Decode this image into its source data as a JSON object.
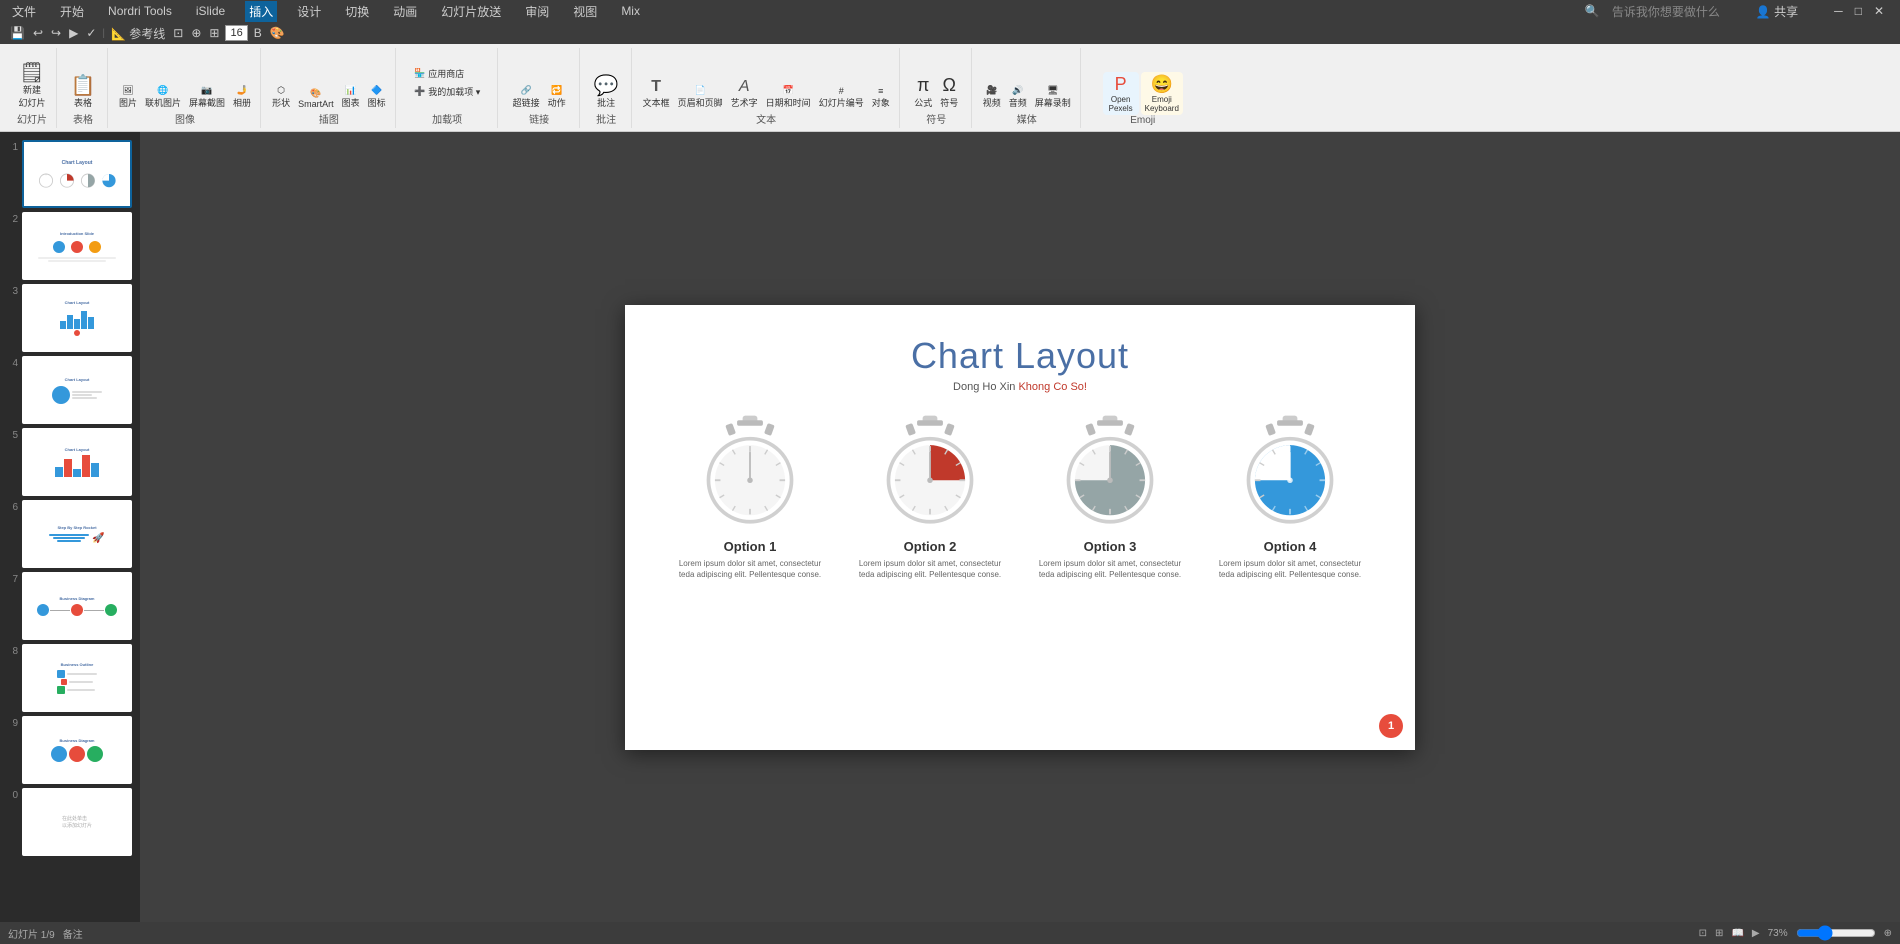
{
  "menubar": {
    "items": [
      "文件",
      "开始",
      "Nordri Tools",
      "iSlide",
      "插入",
      "设计",
      "切换",
      "动画",
      "幻灯片放送",
      "审阅",
      "视图",
      "Mix",
      "告诉我你想要做什么"
    ],
    "active": "插入"
  },
  "ribbon": {
    "tabs": [
      "文件",
      "开始",
      "Nordri Tools",
      "iSlide",
      "插入",
      "设计",
      "切换",
      "动画",
      "幻灯片放送",
      "审阅",
      "视图",
      "Mix"
    ],
    "active_tab": "插入",
    "groups": [
      {
        "label": "幻灯片",
        "items": [
          {
            "icon": "🗒",
            "label": "新建幻灯片"
          },
          {
            "icon": "📋",
            "label": "表格"
          }
        ]
      },
      {
        "label": "图像",
        "items": [
          {
            "icon": "🖼",
            "label": "图片"
          },
          {
            "icon": "🔗",
            "label": "联机图片"
          },
          {
            "icon": "📷",
            "label": "屏幕截图"
          },
          {
            "icon": "🤳",
            "label": "相册"
          }
        ]
      },
      {
        "label": "插图",
        "items": [
          {
            "icon": "⬡",
            "label": "形状"
          },
          {
            "icon": "📊",
            "label": "图表"
          },
          {
            "icon": "🎨",
            "label": "SmartArt"
          }
        ]
      },
      {
        "label": "加载项",
        "items": [
          {
            "icon": "🏪",
            "label": "应用商店"
          },
          {
            "icon": "➕",
            "label": "我的加载项"
          }
        ]
      },
      {
        "label": "链接",
        "items": [
          {
            "icon": "🔗",
            "label": "超链接"
          },
          {
            "icon": "🔁",
            "label": "动作"
          }
        ]
      },
      {
        "label": "批注",
        "items": [
          {
            "icon": "💬",
            "label": "批注"
          }
        ]
      },
      {
        "label": "文本",
        "items": [
          {
            "icon": "T",
            "label": "文本框"
          },
          {
            "icon": "📄",
            "label": "页眉和页脚"
          },
          {
            "icon": "A",
            "label": "艺术字"
          },
          {
            "icon": "📅",
            "label": "日期和时间"
          },
          {
            "icon": "#",
            "label": "幻灯片编号"
          },
          {
            "icon": "≡",
            "label": "对象"
          }
        ]
      },
      {
        "label": "符号",
        "items": [
          {
            "icon": "π",
            "label": "公式"
          },
          {
            "icon": "Ω",
            "label": "符号"
          }
        ]
      },
      {
        "label": "媒体",
        "items": [
          {
            "icon": "🎥",
            "label": "视频"
          },
          {
            "icon": "🔊",
            "label": "音频"
          },
          {
            "icon": "🖥",
            "label": "屏幕录制"
          }
        ]
      },
      {
        "label": "",
        "items": [
          {
            "icon": "P",
            "label": "Open Pexels"
          },
          {
            "icon": "😄",
            "label": "Emoji Keyboard"
          }
        ]
      }
    ]
  },
  "quickaccess": {
    "items": [
      "↩",
      "↪",
      "⟳",
      "⊡",
      "✓",
      "≡",
      "⊕",
      "⊘",
      "⬡"
    ]
  },
  "slides": [
    {
      "number": 1,
      "active": true
    },
    {
      "number": 2,
      "active": false
    },
    {
      "number": 3,
      "active": false
    },
    {
      "number": 4,
      "active": false
    },
    {
      "number": 5,
      "active": false
    },
    {
      "number": 6,
      "active": false
    },
    {
      "number": 7,
      "active": false
    },
    {
      "number": 8,
      "active": false
    },
    {
      "number": 9,
      "active": false
    },
    {
      "number": 0,
      "active": false
    }
  ],
  "slide": {
    "title": "Chart Layout",
    "subtitle_normal": "Dong Ho Xin ",
    "subtitle_highlight": "Khong Co So!",
    "options": [
      {
        "id": 1,
        "label": "Option 1",
        "desc": "Lorem ipsum dolor sit amet, consectetur teda adipiscing elit. Pellentesque conse.",
        "fill_color": "none",
        "fill_percent": 0
      },
      {
        "id": 2,
        "label": "Option 2",
        "desc": "Lorem ipsum dolor sit amet, consectetur teda adipiscing elit. Pellentesque conse.",
        "fill_color": "#c0392b",
        "fill_percent": 33
      },
      {
        "id": 3,
        "label": "Option 3",
        "desc": "Lorem ipsum dolor sit amet, consectetur teda adipiscing elit. Pellentesque conse.",
        "fill_color": "#95a5a6",
        "fill_percent": 66
      },
      {
        "id": 4,
        "label": "Option 4",
        "desc": "Lorem ipsum dolor sit amet, consectetur teda adipiscing elit. Pellentesque conse.",
        "fill_color": "#3498db",
        "fill_percent": 75
      }
    ],
    "page_number": "1"
  },
  "statusbar": {
    "slide_info": "幻灯片 1/9",
    "notes_label": "备注",
    "zoom": "73%"
  }
}
